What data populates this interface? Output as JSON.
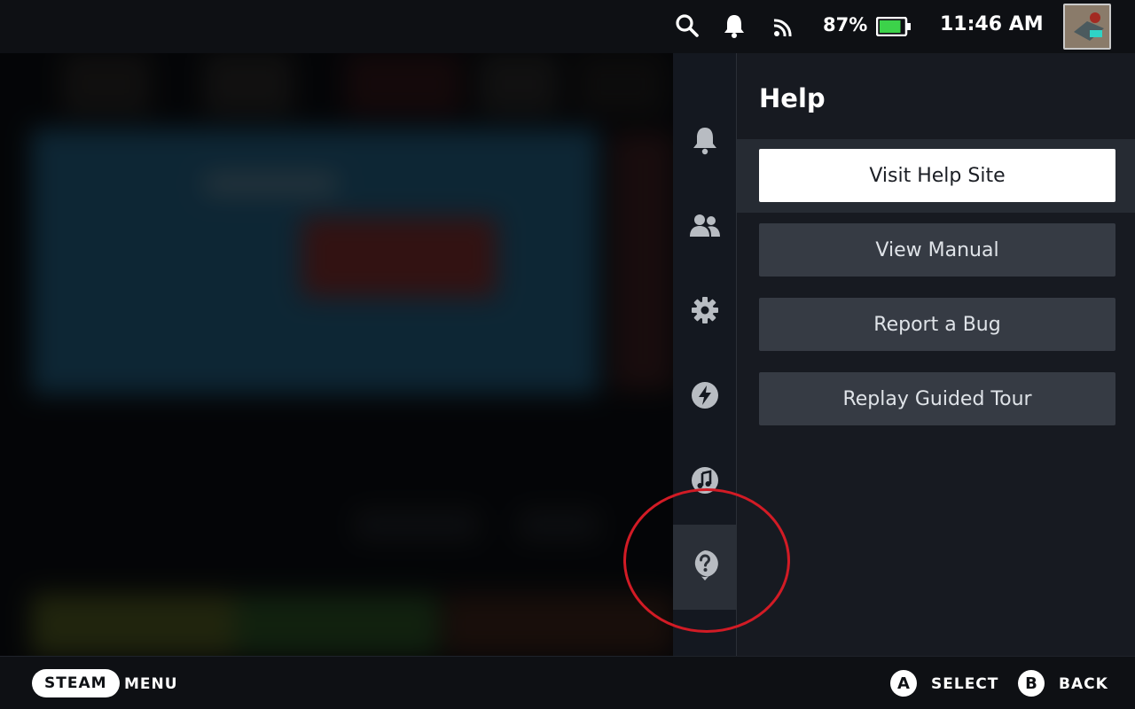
{
  "status_bar": {
    "battery_percent": "87%",
    "battery_level": 0.87,
    "time": "11:46 AM",
    "icons": [
      "search-icon",
      "bell-icon",
      "wifi-icon",
      "battery-icon"
    ]
  },
  "rail": {
    "items": [
      {
        "name": "notifications",
        "icon": "bell-icon"
      },
      {
        "name": "friends",
        "icon": "friends-icon"
      },
      {
        "name": "settings",
        "icon": "gear-icon"
      },
      {
        "name": "performance",
        "icon": "lightning-icon"
      },
      {
        "name": "music",
        "icon": "music-icon"
      },
      {
        "name": "help",
        "icon": "help-icon",
        "active": true
      }
    ]
  },
  "help_panel": {
    "title": "Help",
    "buttons": [
      {
        "label": "Visit Help Site",
        "focused": true
      },
      {
        "label": "View Manual"
      },
      {
        "label": "Report a Bug"
      },
      {
        "label": "Replay Guided Tour"
      }
    ]
  },
  "footer": {
    "steam_label": "STEAM",
    "menu_label": "MENU",
    "select_glyph": "A",
    "select_label": "SELECT",
    "back_glyph": "B",
    "back_label": "BACK"
  },
  "colors": {
    "accent_annotation": "#d21b25",
    "battery_green": "#3cd24a",
    "panel_bg": "#171a21",
    "button_bg": "#363b44"
  }
}
